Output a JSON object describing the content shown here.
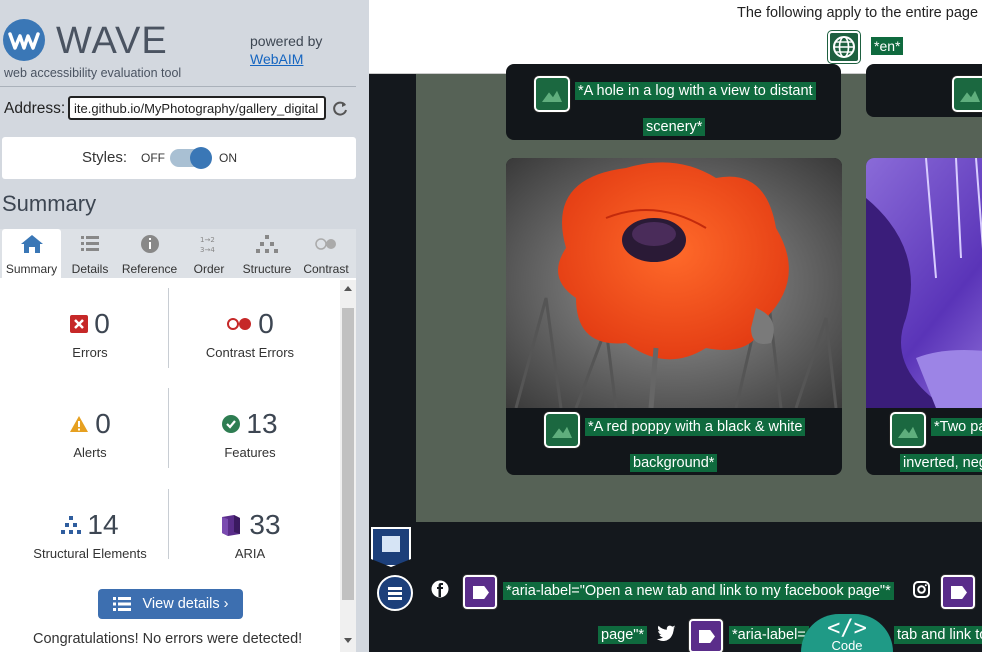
{
  "wave": {
    "title": "WAVE",
    "subtitle": "web accessibility evaluation tool",
    "powered_by": "powered by",
    "webaim": "WebAIM",
    "address_label": "Address:",
    "address_value": "ite.github.io/MyPhotography/gallery_digital",
    "styles_label": "Styles:",
    "styles_off": "OFF",
    "styles_on": "ON",
    "styles_enabled": true,
    "summary_heading": "Summary",
    "tabs": [
      {
        "label": "Summary",
        "icon": "home-icon"
      },
      {
        "label": "Details",
        "icon": "details-list-icon"
      },
      {
        "label": "Reference",
        "icon": "info-icon"
      },
      {
        "label": "Order",
        "icon": "order-icon"
      },
      {
        "label": "Structure",
        "icon": "structure-icon"
      },
      {
        "label": "Contrast",
        "icon": "contrast-icon"
      }
    ],
    "stats": {
      "errors": {
        "value": "0",
        "label": "Errors"
      },
      "contrast_errors": {
        "value": "0",
        "label": "Contrast Errors"
      },
      "alerts": {
        "value": "0",
        "label": "Alerts"
      },
      "features": {
        "value": "13",
        "label": "Features"
      },
      "structural": {
        "value": "14",
        "label": "Structural Elements"
      },
      "aria": {
        "value": "33",
        "label": "ARIA"
      }
    },
    "view_details": "View details ›",
    "congrats": "Congratulations! No errors were detected!"
  },
  "page": {
    "topbar_text": "The following apply to the entire page",
    "lang": "*en*",
    "cards": {
      "log_alt_1": "*A hole in a log with a view to distant",
      "log_alt_2": "scenery*",
      "poppy_alt_1": "*A red poppy with a black & white",
      "poppy_alt_2": "background*",
      "inverted_alt_1": "*Two pa",
      "inverted_alt_2": "inverted, neg"
    },
    "footer": {
      "facebook_aria": "*aria-label=\"Open a new tab and link to my facebook page\"*",
      "page_end": "page\"*",
      "twitter_aria": "*aria-label=",
      "twitter_aria_end": "tab and link to",
      "code_label": "Code",
      "code_glyph": "</>"
    }
  },
  "colors": {
    "wave_bg": "#d3d8df",
    "feature_green": "#0f6a3e",
    "aria_purple": "#5a2d8a",
    "button_blue": "#3d6fb0",
    "gallery_bg": "#566256"
  }
}
